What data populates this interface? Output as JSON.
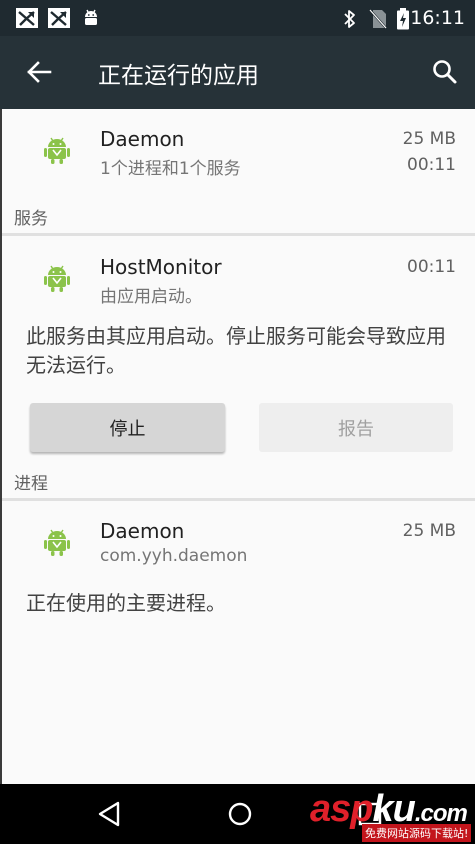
{
  "status_bar": {
    "time": "16:11",
    "left_icons": [
      "no-signal-icon",
      "no-signal-icon",
      "android-debug-icon"
    ],
    "right_icons": [
      "bluetooth-icon",
      "no-sim-icon",
      "battery-charging-icon"
    ]
  },
  "app_bar": {
    "title": "正在运行的应用",
    "back_icon": "arrow-back-icon",
    "search_icon": "search-icon"
  },
  "summary_row": {
    "name": "Daemon",
    "subtitle": "1个进程和1个服务",
    "size": "25 MB",
    "time": "00:11"
  },
  "services": {
    "header": "服务",
    "item": {
      "name": "HostMonitor",
      "subtitle": "由应用启动。",
      "time": "00:11"
    },
    "description": "此服务由其应用启动。停止服务可能会导致应用无法运行。",
    "stop_label": "停止",
    "report_label": "报告"
  },
  "processes": {
    "header": "进程",
    "item": {
      "name": "Daemon",
      "subtitle": "com.yyh.daemon",
      "size": "25 MB"
    },
    "description": "正在使用的主要进程。"
  },
  "nav_bar": {
    "back_icon": "nav-back-icon",
    "home_icon": "nav-home-icon",
    "recents_icon": "nav-recents-icon"
  },
  "watermark": {
    "logo_part1": "asp",
    "logo_part2": "ku",
    "logo_part3": ".com",
    "tagline": "免费网站源码下载站!"
  },
  "colors": {
    "status_bar": "#1f2a30",
    "app_bar": "#263238",
    "android_green": "#8bc34a"
  }
}
